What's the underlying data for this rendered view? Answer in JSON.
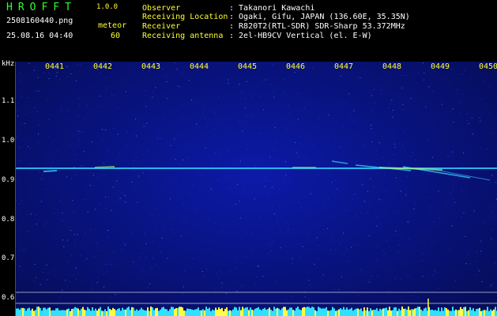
{
  "header": {
    "app_name": "HROFFT",
    "version": "1.0.0",
    "filename": "2508160440.png",
    "datetime": "25.08.16 04:40",
    "meteor_label": "meteor",
    "meteor_count": "60",
    "info": [
      {
        "label": "Observer",
        "value": ": Takanori Kawachi"
      },
      {
        "label": "Receiving Location",
        "value": ": Ogaki, Gifu, JAPAN (136.60E, 35.35N)"
      },
      {
        "label": "Receiver",
        "value": ": R820T2(RTL-SDR) SDR-Sharp 53.372MHz"
      },
      {
        "label": "Receiving antenna",
        "value": ": 2el-HB9CV Vertical (el. E-W)"
      }
    ]
  },
  "axes": {
    "y_unit": "kHz",
    "y_labels": [
      "1.1",
      "1.0",
      "0.9",
      "0.8",
      "0.7",
      "0.6"
    ],
    "x_labels": [
      "0441",
      "0442",
      "0443",
      "0444",
      "0445",
      "0446",
      "0447",
      "0448",
      "0449",
      "0450"
    ]
  },
  "colors": {
    "background": "#000000",
    "spectrum": "#08127a",
    "trace": "#30d0ff",
    "label_yellow": "#ffff30",
    "label_green": "#30ff30",
    "bars": "#30e0ff"
  }
}
